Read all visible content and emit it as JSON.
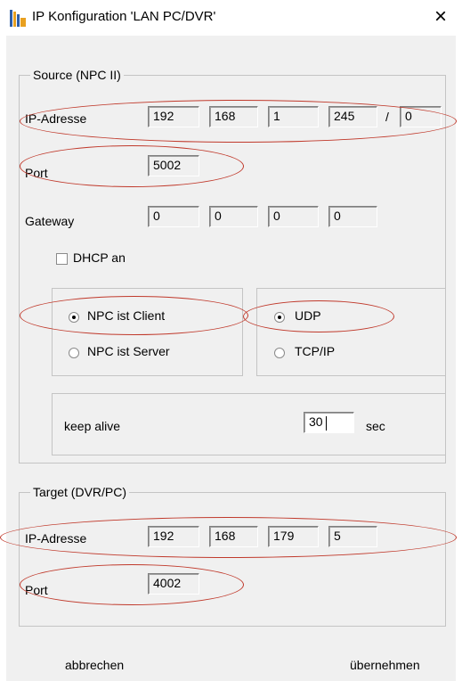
{
  "window": {
    "title": "IP Konfiguration 'LAN PC/DVR'",
    "close_glyph": "×"
  },
  "source": {
    "legend": "Source (NPC II)",
    "ip_label": "IP-Adresse",
    "ip": [
      "192",
      "168",
      "1",
      "245"
    ],
    "mask_sep": "/",
    "mask": "0",
    "port_label": "Port",
    "port": "5002",
    "gateway_label": "Gateway",
    "gateway": [
      "0",
      "0",
      "0",
      "0"
    ],
    "dhcp_label": "DHCP an",
    "dhcp_checked": false,
    "mode": {
      "client_label": "NPC ist Client",
      "server_label": "NPC ist Server",
      "selected": "client"
    },
    "protocol": {
      "udp_label": "UDP",
      "tcp_label": "TCP/IP",
      "selected": "udp"
    },
    "keepalive": {
      "label": "keep alive",
      "value": "30",
      "unit": "sec"
    }
  },
  "target": {
    "legend": "Target (DVR/PC)",
    "ip_label": "IP-Adresse",
    "ip": [
      "192",
      "168",
      "179",
      "5"
    ],
    "port_label": "Port",
    "port": "4002"
  },
  "buttons": {
    "cancel": "abbrechen",
    "apply": "übernehmen"
  },
  "annotation_color": "#c0392b"
}
